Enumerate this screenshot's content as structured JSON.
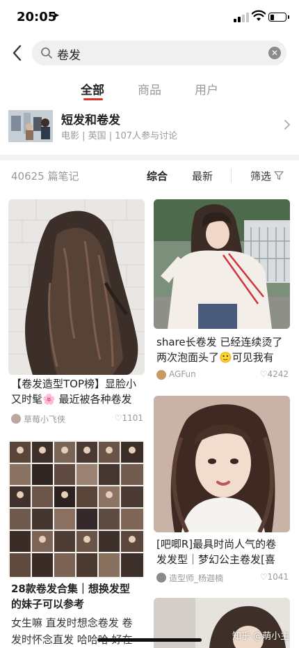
{
  "status_bar": {
    "time": "20:05"
  },
  "search": {
    "query": "卷发"
  },
  "tabs": [
    {
      "label": "全部",
      "active": true
    },
    {
      "label": "商品",
      "active": false
    },
    {
      "label": "用户",
      "active": false
    }
  ],
  "topic": {
    "title": "短发和卷发",
    "subtitle": "电影 | 英国 | 107人参与讨论"
  },
  "filter_bar": {
    "note_count": "40625 篇笔记",
    "sort_options": [
      "综合",
      "最新"
    ],
    "filter_label": "筛选"
  },
  "feed": {
    "left": [
      {
        "title_line1": "【卷发造型TOP榜】显脸小",
        "title_line2": "又时髦🌸 最近被各种卷发",
        "author": "草莓小飞侠",
        "likes": "1101"
      },
      {
        "title_line1": "28款卷发合集｜想换发型",
        "title_line2": "的妹子可以参考",
        "desc_line1": "女生嘛 直发时想念卷发 卷",
        "desc_line2": "发时怀念直发 哈哈哈 好在"
      }
    ],
    "right": [
      {
        "title_line1": "share长卷发 已经连续烫了",
        "title_line2": "两次泡面头了🙂可见我有",
        "author": "AGFun",
        "likes": "4242"
      },
      {
        "title_line1": "[吧唧R]最具时尚人气的卷",
        "title_line2": "发发型｜梦幻公主卷发[喜",
        "author": "造型师_杨迦楠",
        "likes": "1041"
      }
    ]
  },
  "watermark": "知乎 @萌小主",
  "colors": {
    "accent": "#e02e24",
    "muted": "#999999",
    "text": "#222222"
  }
}
